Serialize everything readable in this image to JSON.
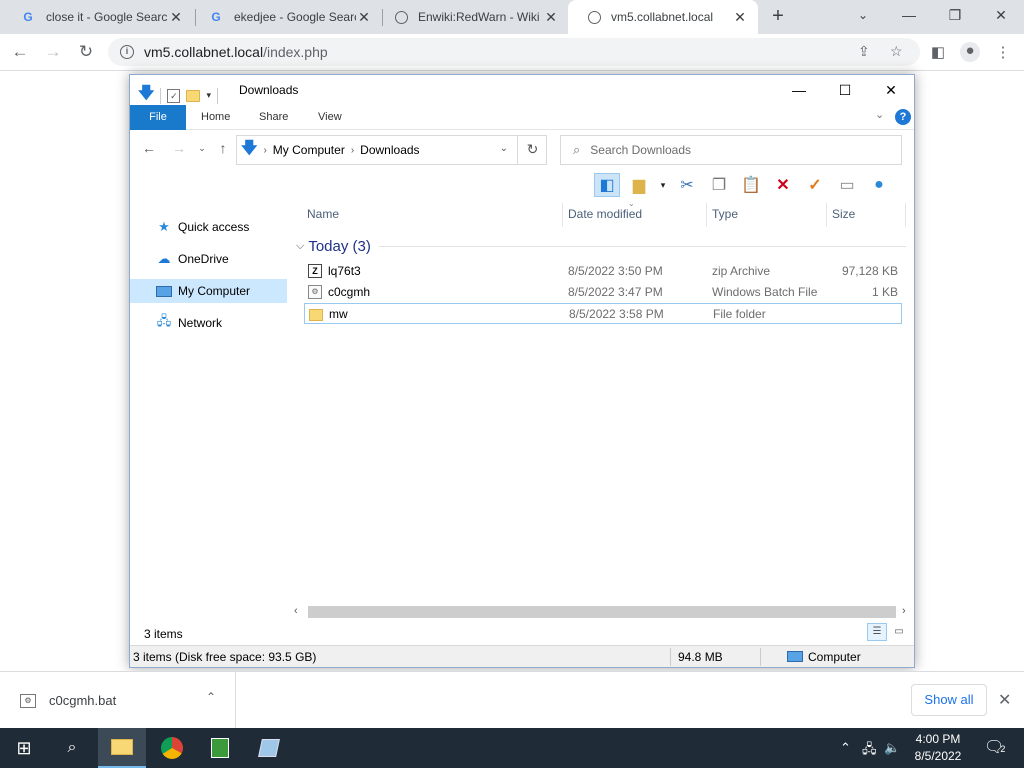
{
  "browser": {
    "tabs": [
      {
        "title": "close it - Google Searc",
        "icon": "google-icon"
      },
      {
        "title": "ekedjee - Google Searc",
        "icon": "google-icon"
      },
      {
        "title": "Enwiki:RedWarn - Wiki",
        "icon": "globe-icon"
      },
      {
        "title": "vm5.collabnet.local",
        "icon": "globe-icon",
        "active": true
      }
    ],
    "new_tab": "+",
    "url_host": "vm5.collabnet.local",
    "url_path": "/index.php"
  },
  "explorer": {
    "title": "Downloads",
    "ribbon_tabs": [
      "File",
      "Home",
      "Share",
      "View"
    ],
    "breadcrumb": [
      "My Computer",
      "Downloads"
    ],
    "search_placeholder": "Search Downloads",
    "sidebar": [
      {
        "label": "Quick access",
        "icon": "star-icon"
      },
      {
        "label": "OneDrive",
        "icon": "cloud-icon"
      },
      {
        "label": "My Computer",
        "icon": "computer-icon",
        "selected": true
      },
      {
        "label": "Network",
        "icon": "network-icon"
      }
    ],
    "columns": [
      "Name",
      "Date modified",
      "Type",
      "Size"
    ],
    "group_label": "Today (3)",
    "files": [
      {
        "name": "lq76t3",
        "date": "8/5/2022 3:50 PM",
        "type": "zip Archive",
        "size": "97,128 KB",
        "icon": "zip-icon"
      },
      {
        "name": "c0cgmh",
        "date": "8/5/2022 3:47 PM",
        "type": "Windows Batch File",
        "size": "1 KB",
        "icon": "batch-file-icon"
      },
      {
        "name": "mw",
        "date": "8/5/2022 3:58 PM",
        "type": "File folder",
        "size": "",
        "icon": "folder-icon",
        "selected": true
      }
    ],
    "item_count": "3 items",
    "status_left": "3 items (Disk free space: 93.5 GB)",
    "status_size": "94.8 MB",
    "status_location": "Computer"
  },
  "shelf": {
    "download_name": "c0cgmh.bat",
    "show_all": "Show all"
  },
  "taskbar": {
    "time": "4:00 PM",
    "date": "8/5/2022",
    "notifications": "2"
  },
  "colors": {
    "ribbon_file": "#1979ca",
    "selection": "#cce8ff",
    "taskbar": "#1f2b36"
  }
}
